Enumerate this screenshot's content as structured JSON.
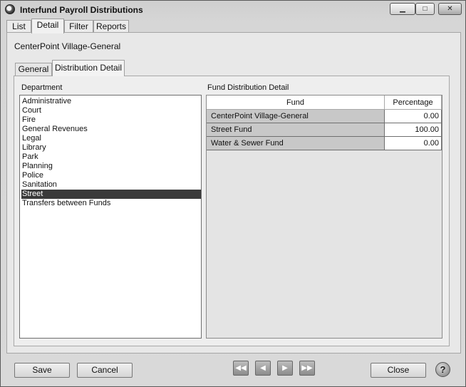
{
  "window": {
    "title": "Interfund Payroll Distributions",
    "minimize_glyph": "▁",
    "maximize_glyph": "□",
    "close_glyph": "✕"
  },
  "tabs": [
    "List",
    "Detail",
    "Filter",
    "Reports"
  ],
  "active_tab": "Detail",
  "record_title": "CenterPoint Village-General",
  "subtabs": [
    "General",
    "Distribution Detail"
  ],
  "active_subtab": "Distribution Detail",
  "department": {
    "label": "Department",
    "items": [
      "Administrative",
      "Court",
      "Fire",
      "General Revenues",
      "Legal",
      "Library",
      "Park",
      "Planning",
      "Police",
      "Sanitation",
      "Street",
      "Transfers between Funds"
    ],
    "selected": "Street"
  },
  "fund_detail": {
    "label": "Fund Distribution Detail",
    "columns": [
      "Fund",
      "Percentage"
    ],
    "rows": [
      {
        "fund": "CenterPoint Village-General",
        "percentage": "0.00"
      },
      {
        "fund": "Street Fund",
        "percentage": "100.00"
      },
      {
        "fund": "Water & Sewer Fund",
        "percentage": "0.00"
      }
    ]
  },
  "buttons": {
    "save": "Save",
    "cancel": "Cancel",
    "close": "Close",
    "help": "?"
  },
  "nav": {
    "first": "◀◀",
    "prev": "◀",
    "next": "▶",
    "last": "▶▶"
  }
}
